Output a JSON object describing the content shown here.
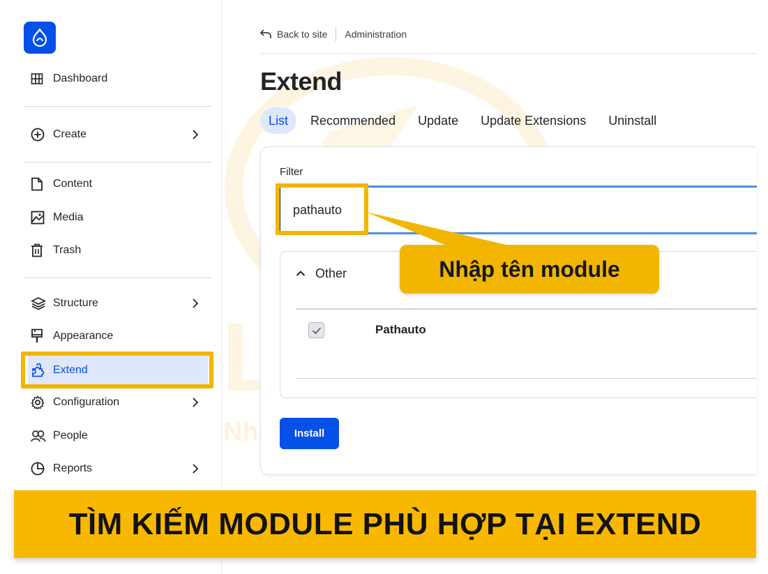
{
  "sidebar": {
    "items": [
      {
        "label": "Dashboard",
        "icon": "dashboard-icon"
      },
      {
        "label": "Create",
        "icon": "plus-circle-icon",
        "has_submenu": true
      },
      {
        "label": "Content",
        "icon": "file-icon"
      },
      {
        "label": "Media",
        "icon": "image-icon"
      },
      {
        "label": "Trash",
        "icon": "trash-icon"
      },
      {
        "label": "Structure",
        "icon": "layers-icon",
        "has_submenu": true
      },
      {
        "label": "Appearance",
        "icon": "paint-icon"
      },
      {
        "label": "Extend",
        "icon": "puzzle-icon",
        "active": true
      },
      {
        "label": "Configuration",
        "icon": "gear-icon",
        "has_submenu": true
      },
      {
        "label": "People",
        "icon": "people-icon"
      },
      {
        "label": "Reports",
        "icon": "pie-chart-icon",
        "has_submenu": true
      }
    ]
  },
  "breadcrumb": {
    "back_label": "Back to site",
    "current": "Administration"
  },
  "page": {
    "title": "Extend",
    "tabs": [
      {
        "label": "List",
        "active": true
      },
      {
        "label": "Recommended"
      },
      {
        "label": "Update"
      },
      {
        "label": "Update Extensions"
      },
      {
        "label": "Uninstall"
      }
    ]
  },
  "filter": {
    "label": "Filter",
    "value": "pathauto"
  },
  "module_group": {
    "label": "Other",
    "modules": [
      {
        "name": "Pathauto",
        "checked": true
      }
    ]
  },
  "install_button": "Install",
  "annotation": {
    "callout": "Nhập tên module",
    "banner": "TÌM KIẾM MODULE PHÙ HỢP TẠI EXTEND",
    "watermark_brand": "LIGHT",
    "watermark_slogan": "Nhanh - Chuẩn - Đẹp"
  },
  "colors": {
    "accent": "#0550e6",
    "highlight": "#f2b600",
    "active_bg": "#dfe7fb"
  }
}
